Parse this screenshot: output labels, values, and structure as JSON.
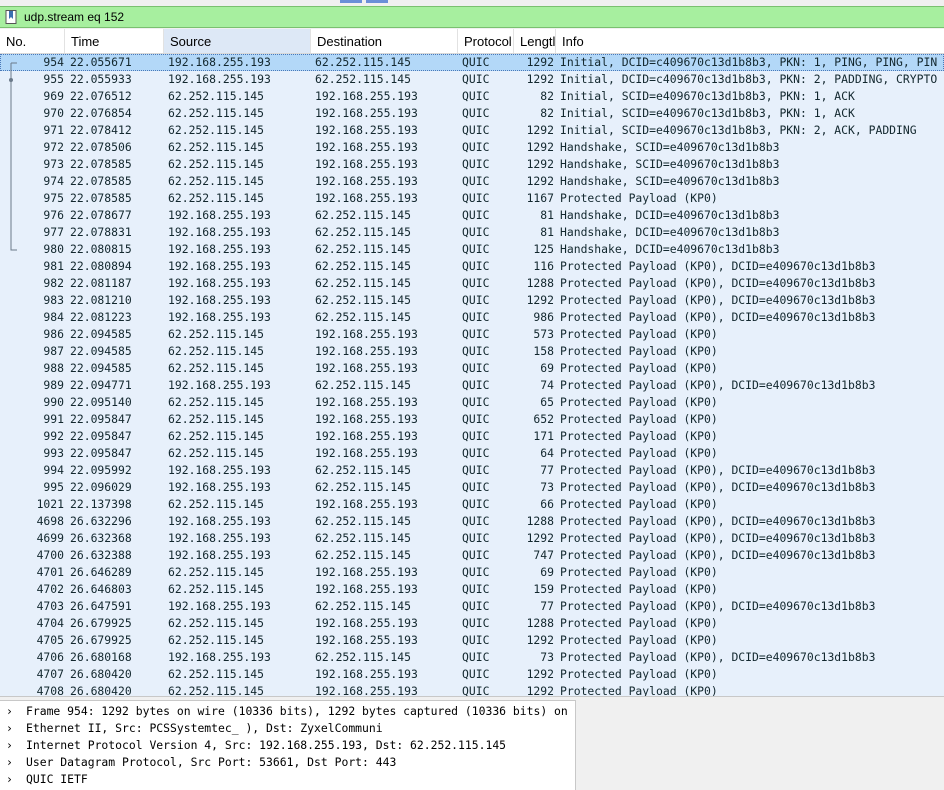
{
  "filter": {
    "value": "udp.stream eq 152"
  },
  "columns": [
    {
      "key": "no",
      "label": "No."
    },
    {
      "key": "time",
      "label": "Time"
    },
    {
      "key": "source",
      "label": "Source"
    },
    {
      "key": "destination",
      "label": "Destination"
    },
    {
      "key": "protocol",
      "label": "Protocol"
    },
    {
      "key": "length",
      "label": "Lengtl"
    },
    {
      "key": "info",
      "label": "Info"
    }
  ],
  "packets": [
    {
      "no": "954",
      "time": "22.055671",
      "source": "192.168.255.193",
      "destination": "62.252.115.145",
      "protocol": "QUIC",
      "length": "1292",
      "info": "Initial, DCID=c409670c13d1b8b3, PKN: 1, PING, PING, PIN"
    },
    {
      "no": "955",
      "time": "22.055933",
      "source": "192.168.255.193",
      "destination": "62.252.115.145",
      "protocol": "QUIC",
      "length": "1292",
      "info": "Initial, DCID=c409670c13d1b8b3, PKN: 2, PADDING, CRYPTO"
    },
    {
      "no": "969",
      "time": "22.076512",
      "source": "62.252.115.145",
      "destination": "192.168.255.193",
      "protocol": "QUIC",
      "length": "82",
      "info": "Initial, SCID=e409670c13d1b8b3, PKN: 1, ACK"
    },
    {
      "no": "970",
      "time": "22.076854",
      "source": "62.252.115.145",
      "destination": "192.168.255.193",
      "protocol": "QUIC",
      "length": "82",
      "info": "Initial, SCID=e409670c13d1b8b3, PKN: 1, ACK"
    },
    {
      "no": "971",
      "time": "22.078412",
      "source": "62.252.115.145",
      "destination": "192.168.255.193",
      "protocol": "QUIC",
      "length": "1292",
      "info": "Initial, SCID=e409670c13d1b8b3, PKN: 2, ACK, PADDING"
    },
    {
      "no": "972",
      "time": "22.078506",
      "source": "62.252.115.145",
      "destination": "192.168.255.193",
      "protocol": "QUIC",
      "length": "1292",
      "info": "Handshake, SCID=e409670c13d1b8b3"
    },
    {
      "no": "973",
      "time": "22.078585",
      "source": "62.252.115.145",
      "destination": "192.168.255.193",
      "protocol": "QUIC",
      "length": "1292",
      "info": "Handshake, SCID=e409670c13d1b8b3"
    },
    {
      "no": "974",
      "time": "22.078585",
      "source": "62.252.115.145",
      "destination": "192.168.255.193",
      "protocol": "QUIC",
      "length": "1292",
      "info": "Handshake, SCID=e409670c13d1b8b3"
    },
    {
      "no": "975",
      "time": "22.078585",
      "source": "62.252.115.145",
      "destination": "192.168.255.193",
      "protocol": "QUIC",
      "length": "1167",
      "info": "Protected Payload (KP0)"
    },
    {
      "no": "976",
      "time": "22.078677",
      "source": "192.168.255.193",
      "destination": "62.252.115.145",
      "protocol": "QUIC",
      "length": "81",
      "info": "Handshake, DCID=e409670c13d1b8b3"
    },
    {
      "no": "977",
      "time": "22.078831",
      "source": "192.168.255.193",
      "destination": "62.252.115.145",
      "protocol": "QUIC",
      "length": "81",
      "info": "Handshake, DCID=e409670c13d1b8b3"
    },
    {
      "no": "980",
      "time": "22.080815",
      "source": "192.168.255.193",
      "destination": "62.252.115.145",
      "protocol": "QUIC",
      "length": "125",
      "info": "Handshake, DCID=e409670c13d1b8b3"
    },
    {
      "no": "981",
      "time": "22.080894",
      "source": "192.168.255.193",
      "destination": "62.252.115.145",
      "protocol": "QUIC",
      "length": "116",
      "info": "Protected Payload (KP0), DCID=e409670c13d1b8b3"
    },
    {
      "no": "982",
      "time": "22.081187",
      "source": "192.168.255.193",
      "destination": "62.252.115.145",
      "protocol": "QUIC",
      "length": "1288",
      "info": "Protected Payload (KP0), DCID=e409670c13d1b8b3"
    },
    {
      "no": "983",
      "time": "22.081210",
      "source": "192.168.255.193",
      "destination": "62.252.115.145",
      "protocol": "QUIC",
      "length": "1292",
      "info": "Protected Payload (KP0), DCID=e409670c13d1b8b3"
    },
    {
      "no": "984",
      "time": "22.081223",
      "source": "192.168.255.193",
      "destination": "62.252.115.145",
      "protocol": "QUIC",
      "length": "986",
      "info": "Protected Payload (KP0), DCID=e409670c13d1b8b3"
    },
    {
      "no": "986",
      "time": "22.094585",
      "source": "62.252.115.145",
      "destination": "192.168.255.193",
      "protocol": "QUIC",
      "length": "573",
      "info": "Protected Payload (KP0)"
    },
    {
      "no": "987",
      "time": "22.094585",
      "source": "62.252.115.145",
      "destination": "192.168.255.193",
      "protocol": "QUIC",
      "length": "158",
      "info": "Protected Payload (KP0)"
    },
    {
      "no": "988",
      "time": "22.094585",
      "source": "62.252.115.145",
      "destination": "192.168.255.193",
      "protocol": "QUIC",
      "length": "69",
      "info": "Protected Payload (KP0)"
    },
    {
      "no": "989",
      "time": "22.094771",
      "source": "192.168.255.193",
      "destination": "62.252.115.145",
      "protocol": "QUIC",
      "length": "74",
      "info": "Protected Payload (KP0), DCID=e409670c13d1b8b3"
    },
    {
      "no": "990",
      "time": "22.095140",
      "source": "62.252.115.145",
      "destination": "192.168.255.193",
      "protocol": "QUIC",
      "length": "65",
      "info": "Protected Payload (KP0)"
    },
    {
      "no": "991",
      "time": "22.095847",
      "source": "62.252.115.145",
      "destination": "192.168.255.193",
      "protocol": "QUIC",
      "length": "652",
      "info": "Protected Payload (KP0)"
    },
    {
      "no": "992",
      "time": "22.095847",
      "source": "62.252.115.145",
      "destination": "192.168.255.193",
      "protocol": "QUIC",
      "length": "171",
      "info": "Protected Payload (KP0)"
    },
    {
      "no": "993",
      "time": "22.095847",
      "source": "62.252.115.145",
      "destination": "192.168.255.193",
      "protocol": "QUIC",
      "length": "64",
      "info": "Protected Payload (KP0)"
    },
    {
      "no": "994",
      "time": "22.095992",
      "source": "192.168.255.193",
      "destination": "62.252.115.145",
      "protocol": "QUIC",
      "length": "77",
      "info": "Protected Payload (KP0), DCID=e409670c13d1b8b3"
    },
    {
      "no": "995",
      "time": "22.096029",
      "source": "192.168.255.193",
      "destination": "62.252.115.145",
      "protocol": "QUIC",
      "length": "73",
      "info": "Protected Payload (KP0), DCID=e409670c13d1b8b3"
    },
    {
      "no": "1021",
      "time": "22.137398",
      "source": "62.252.115.145",
      "destination": "192.168.255.193",
      "protocol": "QUIC",
      "length": "66",
      "info": "Protected Payload (KP0)"
    },
    {
      "no": "4698",
      "time": "26.632296",
      "source": "192.168.255.193",
      "destination": "62.252.115.145",
      "protocol": "QUIC",
      "length": "1288",
      "info": "Protected Payload (KP0), DCID=e409670c13d1b8b3"
    },
    {
      "no": "4699",
      "time": "26.632368",
      "source": "192.168.255.193",
      "destination": "62.252.115.145",
      "protocol": "QUIC",
      "length": "1292",
      "info": "Protected Payload (KP0), DCID=e409670c13d1b8b3"
    },
    {
      "no": "4700",
      "time": "26.632388",
      "source": "192.168.255.193",
      "destination": "62.252.115.145",
      "protocol": "QUIC",
      "length": "747",
      "info": "Protected Payload (KP0), DCID=e409670c13d1b8b3"
    },
    {
      "no": "4701",
      "time": "26.646289",
      "source": "62.252.115.145",
      "destination": "192.168.255.193",
      "protocol": "QUIC",
      "length": "69",
      "info": "Protected Payload (KP0)"
    },
    {
      "no": "4702",
      "time": "26.646803",
      "source": "62.252.115.145",
      "destination": "192.168.255.193",
      "protocol": "QUIC",
      "length": "159",
      "info": "Protected Payload (KP0)"
    },
    {
      "no": "4703",
      "time": "26.647591",
      "source": "192.168.255.193",
      "destination": "62.252.115.145",
      "protocol": "QUIC",
      "length": "77",
      "info": "Protected Payload (KP0), DCID=e409670c13d1b8b3"
    },
    {
      "no": "4704",
      "time": "26.679925",
      "source": "62.252.115.145",
      "destination": "192.168.255.193",
      "protocol": "QUIC",
      "length": "1288",
      "info": "Protected Payload (KP0)"
    },
    {
      "no": "4705",
      "time": "26.679925",
      "source": "62.252.115.145",
      "destination": "192.168.255.193",
      "protocol": "QUIC",
      "length": "1292",
      "info": "Protected Payload (KP0)"
    },
    {
      "no": "4706",
      "time": "26.680168",
      "source": "192.168.255.193",
      "destination": "62.252.115.145",
      "protocol": "QUIC",
      "length": "73",
      "info": "Protected Payload (KP0), DCID=e409670c13d1b8b3"
    },
    {
      "no": "4707",
      "time": "26.680420",
      "source": "62.252.115.145",
      "destination": "192.168.255.193",
      "protocol": "QUIC",
      "length": "1292",
      "info": "Protected Payload (KP0)"
    },
    {
      "no": "4708",
      "time": "26.680420",
      "source": "62.252.115.145",
      "destination": "192.168.255.193",
      "protocol": "QUIC",
      "length": "1292",
      "info": "Protected Payload (KP0)"
    }
  ],
  "selected_packet": "954",
  "details": [
    {
      "text": "Frame 954: 1292 bytes on wire (10336 bits), 1292 bytes captured (10336 bits) on"
    },
    {
      "text": "Ethernet II, Src: PCSSystemtec_                         ), Dst: ZyxelCommuni"
    },
    {
      "text": "Internet Protocol Version 4, Src: 192.168.255.193, Dst: 62.252.115.145"
    },
    {
      "text": "User Datagram Protocol, Src Port: 53661, Dst Port: 443"
    },
    {
      "text": "QUIC IETF"
    }
  ],
  "icons": {
    "filter": "bookmark-icon",
    "expand": "chevron-right-icon"
  },
  "colors": {
    "filter_bg": "#a7ef9f",
    "row_bg": "#e7f0fb",
    "selected_bg": "#b3d8f8"
  }
}
